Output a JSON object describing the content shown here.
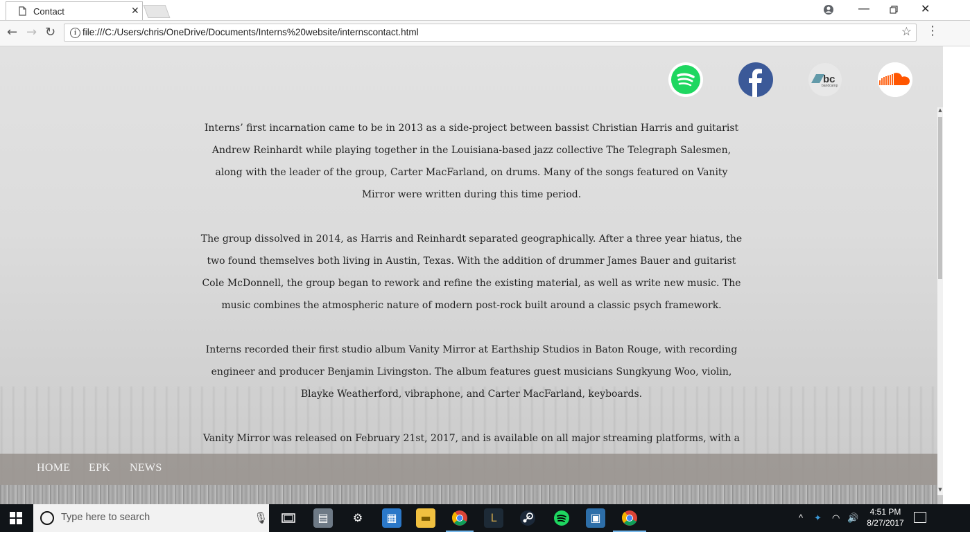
{
  "browser": {
    "tab_title": "Contact",
    "url": "file:///C:/Users/chris/OneDrive/Documents/Interns%20website/internscontact.html"
  },
  "social": [
    {
      "name": "spotify",
      "label": ""
    },
    {
      "name": "facebook",
      "label": "f"
    },
    {
      "name": "bandcamp",
      "label": "bc",
      "sub": "bandcamp"
    },
    {
      "name": "soundcloud",
      "label": ""
    }
  ],
  "content": {
    "p1": "Interns’ first incarnation came to be in 2013 as a side-project between bassist Christian Harris and guitarist Andrew Reinhardt while playing together in the Louisiana-based jazz collective The Telegraph Salesmen, along with the leader of the group, Carter MacFarland, on drums. Many of the songs featured on Vanity Mirror were written during this time period.",
    "p2": "The group dissolved in 2014, as Harris and Reinhardt separated geographically. After a three year hiatus, the two found themselves both living in Austin, Texas. With the addition of drummer James Bauer and guitarist Cole McDonnell, the group began to rework and refine the existing material, as well as write new music. The music combines the atmospheric nature of modern post-rock built around a classic psych framework.",
    "p3": "Interns recorded their first studio album Vanity Mirror at Earthship Studios in Baton Rouge, with recording engineer and producer Benjamin Livingston. The album features guest musicians Sungkyung Woo, violin, Blayke Weatherford, vibraphone, and Carter MacFarland, keyboards.",
    "p4": "Vanity Mirror was released on February 21st, 2017, and is available on all major streaming platforms, with a"
  },
  "nav": {
    "home": "HOME",
    "epk": "EPK",
    "news": "NEWS"
  },
  "taskbar": {
    "search_placeholder": "Type here to search",
    "time": "4:51 PM",
    "date": "8/27/2017"
  },
  "colors": {
    "spotify": "#1ed760",
    "facebook": "#3b5998",
    "soundcloud": "#ff5500",
    "taskbar": "#101418"
  }
}
